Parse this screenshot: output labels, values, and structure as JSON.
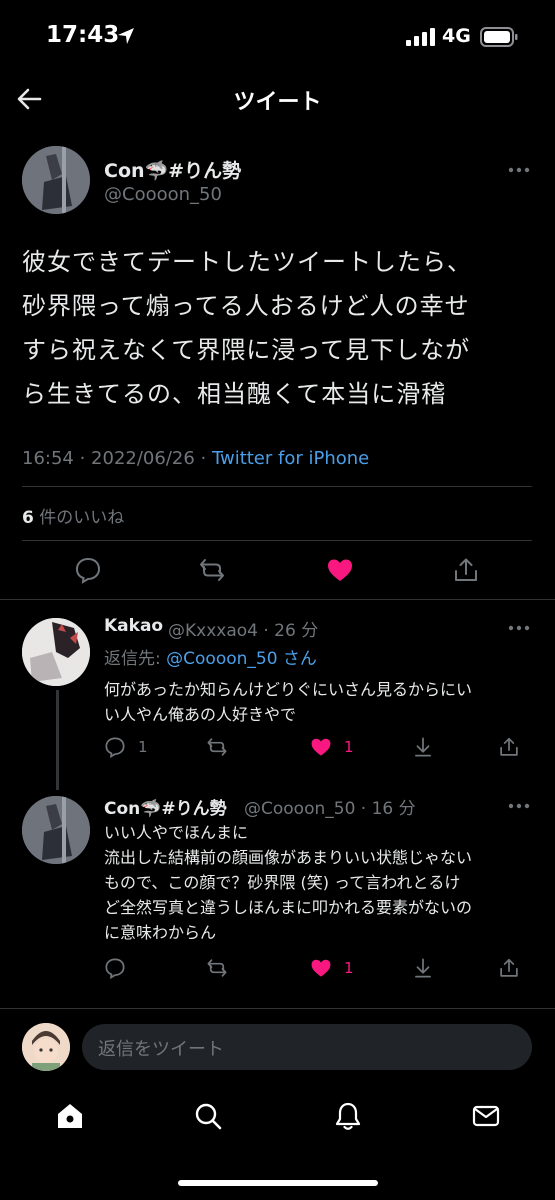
{
  "status_bar": {
    "time": "17:43",
    "network": "4G"
  },
  "header": {
    "title": "ツイート"
  },
  "main_tweet": {
    "display_name": "Con🦈#りん勢",
    "handle": "@Coooon_50",
    "lines": [
      "彼女できてデートしたツイートしたら、",
      "砂界隈って煽ってる人おるけど人の幸せ",
      "すら祝えなくて界隈に浸って見下しなが",
      "ら生きてるの、相当醜くて本当に滑稽"
    ],
    "timestamp": "16:54 · 2022/06/26 · ",
    "source": "Twitter for iPhone",
    "likes_count": "6",
    "likes_label": "件のいいね"
  },
  "replies": [
    {
      "display_name": "Kakao",
      "handle": "@Kxxxao4 · 26 分",
      "reply_to_prefix": "返信先: ",
      "reply_to_handle": "@Coooon_50 さん",
      "lines": [
        "何があったか知らんけどりぐにいさん見るからにい",
        "い人やん俺あの人好きやで"
      ],
      "reply_count": "1",
      "like_count": "1"
    },
    {
      "display_name": "Con🦈#りん勢",
      "handle": "@Coooon_50 · 16 分",
      "lines": [
        "いい人やでほんまに",
        "流出した結構前の顔画像があまりいい状態じゃない",
        "もので、この顔で？砂界隈 (笑) って言われとるけ",
        "ど全然写真と違うしほんまに叩かれる要素がないの",
        "に意味わからん"
      ],
      "like_count": "1"
    }
  ],
  "compose": {
    "placeholder": "返信をツイート"
  },
  "colors": {
    "accent": "#1d9bf0",
    "like": "#f91880",
    "muted": "#71767b"
  }
}
